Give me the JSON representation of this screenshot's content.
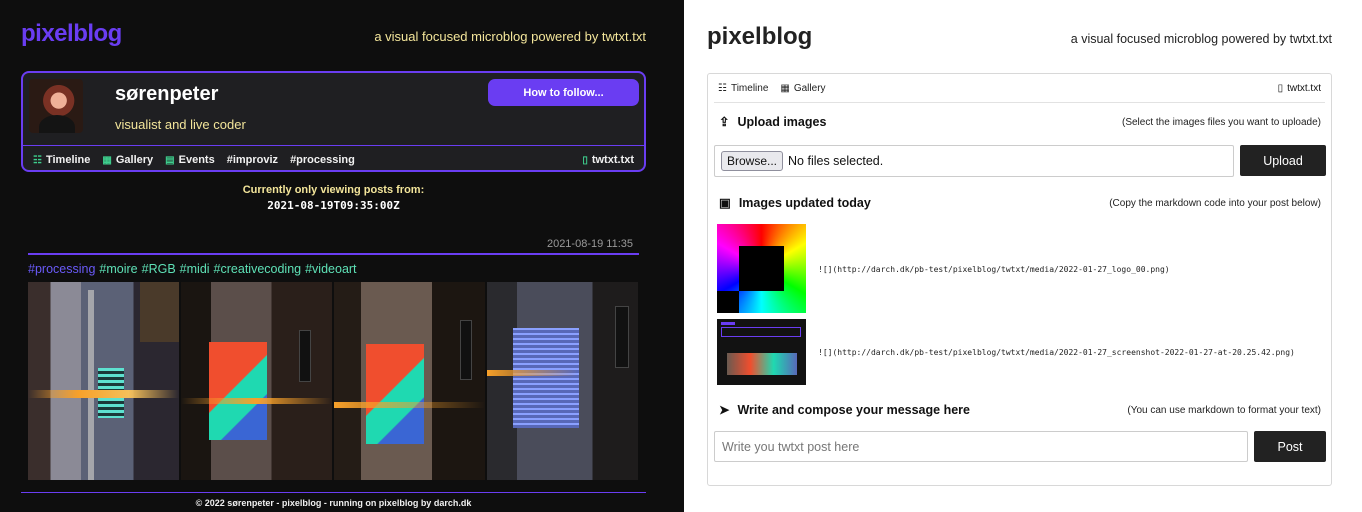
{
  "left": {
    "brand": "pixelblog",
    "tagline": "a visual focused microblog powered by twtxt.txt",
    "profile": {
      "name": "sørenpeter",
      "bio": "visualist and live coder",
      "follow_label": "How to follow..."
    },
    "nav": {
      "timeline": "Timeline",
      "gallery": "Gallery",
      "events": "Events",
      "tags": [
        "#improviz",
        "#processing"
      ],
      "twtxt": "twtxt.txt"
    },
    "viewing_label": "Currently only viewing posts from:",
    "viewing_date": "2021-08-19T09:35:00Z",
    "post": {
      "date": "2021-08-19 11:35",
      "hashtags": [
        "#processing",
        "#moire",
        "#RGB",
        "#midi",
        "#creativecoding",
        "#videoart"
      ]
    },
    "footer": "© 2022 sørenpeter - pixelblog - running on pixelblog by darch.dk"
  },
  "right": {
    "brand": "pixelblog",
    "tagline": "a visual focused microblog powered by twtxt.txt",
    "nav": {
      "timeline": "Timeline",
      "gallery": "Gallery",
      "twtxt": "twtxt.txt"
    },
    "upload": {
      "title": "Upload images",
      "hint": "(Select the images files you want to uploade)",
      "browse_label": "Browse...",
      "file_status": "No files selected.",
      "button": "Upload"
    },
    "today": {
      "title": "Images updated today",
      "hint": "(Copy the markdown code into your post below)",
      "images": [
        {
          "markdown": "![](http://darch.dk/pb-test/pixelblog/twtxt/media/2022-01-27_logo_00.png)"
        },
        {
          "markdown": "![](http://darch.dk/pb-test/pixelblog/twtxt/media/2022-01-27_screenshot-2022-01-27-at-20.25.42.png)"
        }
      ]
    },
    "compose": {
      "title": "Write and compose your message here",
      "hint": "(You can use markdown to format your text)",
      "placeholder": "Write you twtxt post here",
      "button": "Post"
    }
  },
  "colors": {
    "accent": "#6a3df2",
    "dark_bg": "#0e0e0e",
    "yellow_text": "#f3e59a",
    "green_icon": "#3ecf8e"
  }
}
